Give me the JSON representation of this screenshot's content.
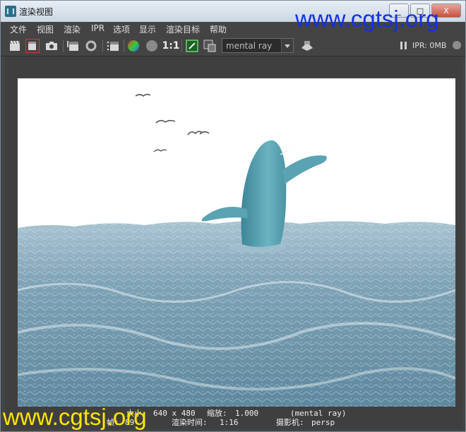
{
  "window": {
    "title": "渲染视图",
    "buttons": [
      "_",
      "□",
      "X"
    ]
  },
  "watermark": "www.cgtsj.org",
  "menu": [
    "文件",
    "视图",
    "渲染",
    "IPR",
    "选项",
    "显示",
    "渲染目标",
    "帮助"
  ],
  "toolbar": {
    "ratio_label": "1:1",
    "renderer": "mental ray",
    "ipr_label": "IPR: 0MB",
    "icons": [
      "redo-render-icon",
      "render-region-icon",
      "snapshot-icon",
      "ipr-render-icon",
      "refresh-icon",
      "render-sequence-icon",
      "rgb-channels-icon",
      "alpha-channel-icon",
      "real-size-icon",
      "keep-image-icon",
      "remove-image-icon",
      "render-settings-icon",
      "pause-icon"
    ]
  },
  "status": {
    "size_label": "大小:",
    "size_value": "640 x 480",
    "zoom_label": "缩放:",
    "zoom_value": "1.000",
    "renderer_value": "(mental ray)",
    "frame_label": "帧:",
    "frame_value": "89",
    "time_label": "渲染时间:",
    "time_value": "1:16",
    "camera_label": "摄影机:",
    "camera_value": "persp"
  },
  "colors": {
    "panel": "#444444",
    "ocean": "#6e94a8",
    "whale": "#5a9fae",
    "watermark_top": "#1330e6",
    "watermark_bottom": "#ffe600"
  }
}
